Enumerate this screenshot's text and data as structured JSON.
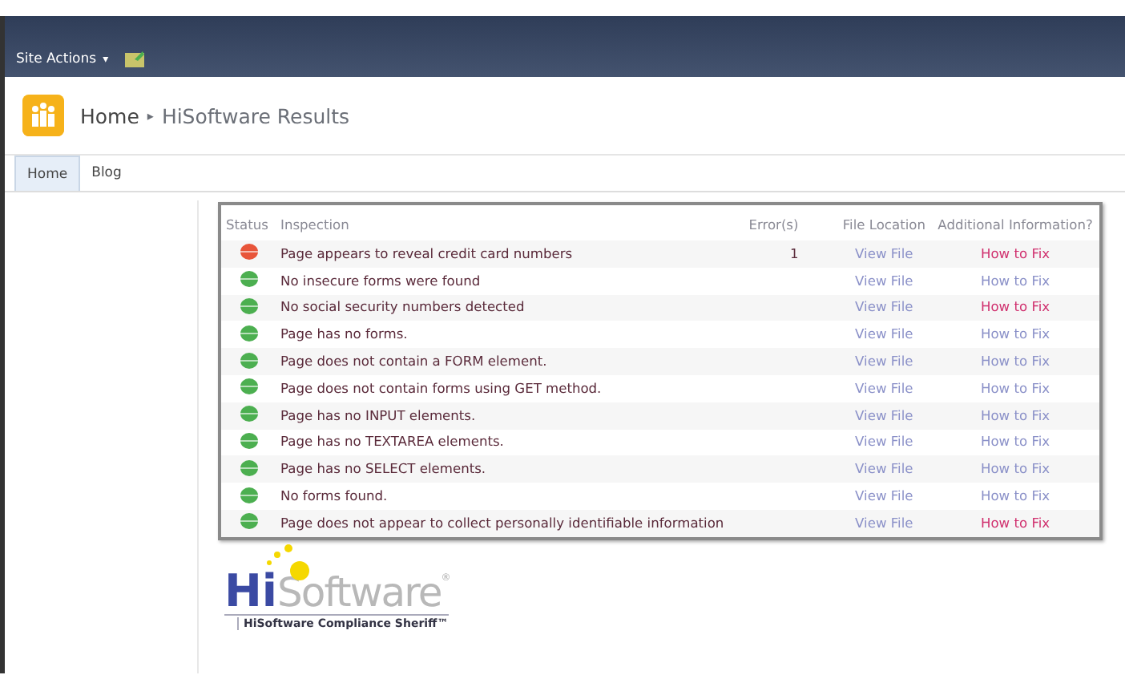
{
  "ribbon": {
    "site_actions": "Site Actions",
    "caret": "▾"
  },
  "breadcrumb": {
    "home": "Home",
    "separator": "▸",
    "current": "HiSoftware Results"
  },
  "tabs": [
    {
      "label": "Home",
      "selected": true
    },
    {
      "label": "Blog",
      "selected": false
    }
  ],
  "table": {
    "columns": [
      "Status",
      "Inspection",
      "Error(s)",
      "File Location",
      "Additional Information?"
    ],
    "rows": [
      {
        "error": true,
        "inspection": "Page appears to reveal credit card numbers",
        "errors": "1",
        "file": "View File",
        "info": "How to Fix",
        "info_visited": true
      },
      {
        "error": false,
        "inspection": "No insecure forms were found",
        "file": "View File",
        "info": "How to Fix",
        "info_visited": false
      },
      {
        "error": false,
        "inspection": "No social security numbers detected",
        "file": "View File",
        "info": "How to Fix",
        "info_visited": true
      },
      {
        "error": false,
        "inspection": "Page has no forms.",
        "file": "View File",
        "info": "How to Fix",
        "info_visited": false
      },
      {
        "error": false,
        "inspection": "Page does not contain a FORM element.",
        "file": "View File",
        "info": "How to Fix",
        "info_visited": false
      },
      {
        "error": false,
        "inspection": "Page does not contain forms using GET method.",
        "file": "View File",
        "info": "How to Fix",
        "info_visited": false
      },
      {
        "error": false,
        "inspection": "Page has no INPUT elements.",
        "file": "View File",
        "info": "How to Fix",
        "info_visited": false
      },
      {
        "error": false,
        "inspection": "Page has no TEXTAREA elements.",
        "file": "View File",
        "info": "How to Fix",
        "info_visited": false
      },
      {
        "error": false,
        "inspection": "Page has no SELECT elements.",
        "file": "View File",
        "info": "How to Fix",
        "info_visited": false
      },
      {
        "error": false,
        "inspection": "No forms found.",
        "file": "View File",
        "info": "How to Fix",
        "info_visited": false
      },
      {
        "error": false,
        "inspection": "Page does not appear to collect personally identifiable information",
        "file": "View File",
        "info": "How to Fix",
        "info_visited": true
      }
    ]
  },
  "logo": {
    "brand_left": "Hi",
    "brand_right": "Software",
    "registered": "®",
    "tagline": "HiSoftware Compliance Sheriff™"
  }
}
